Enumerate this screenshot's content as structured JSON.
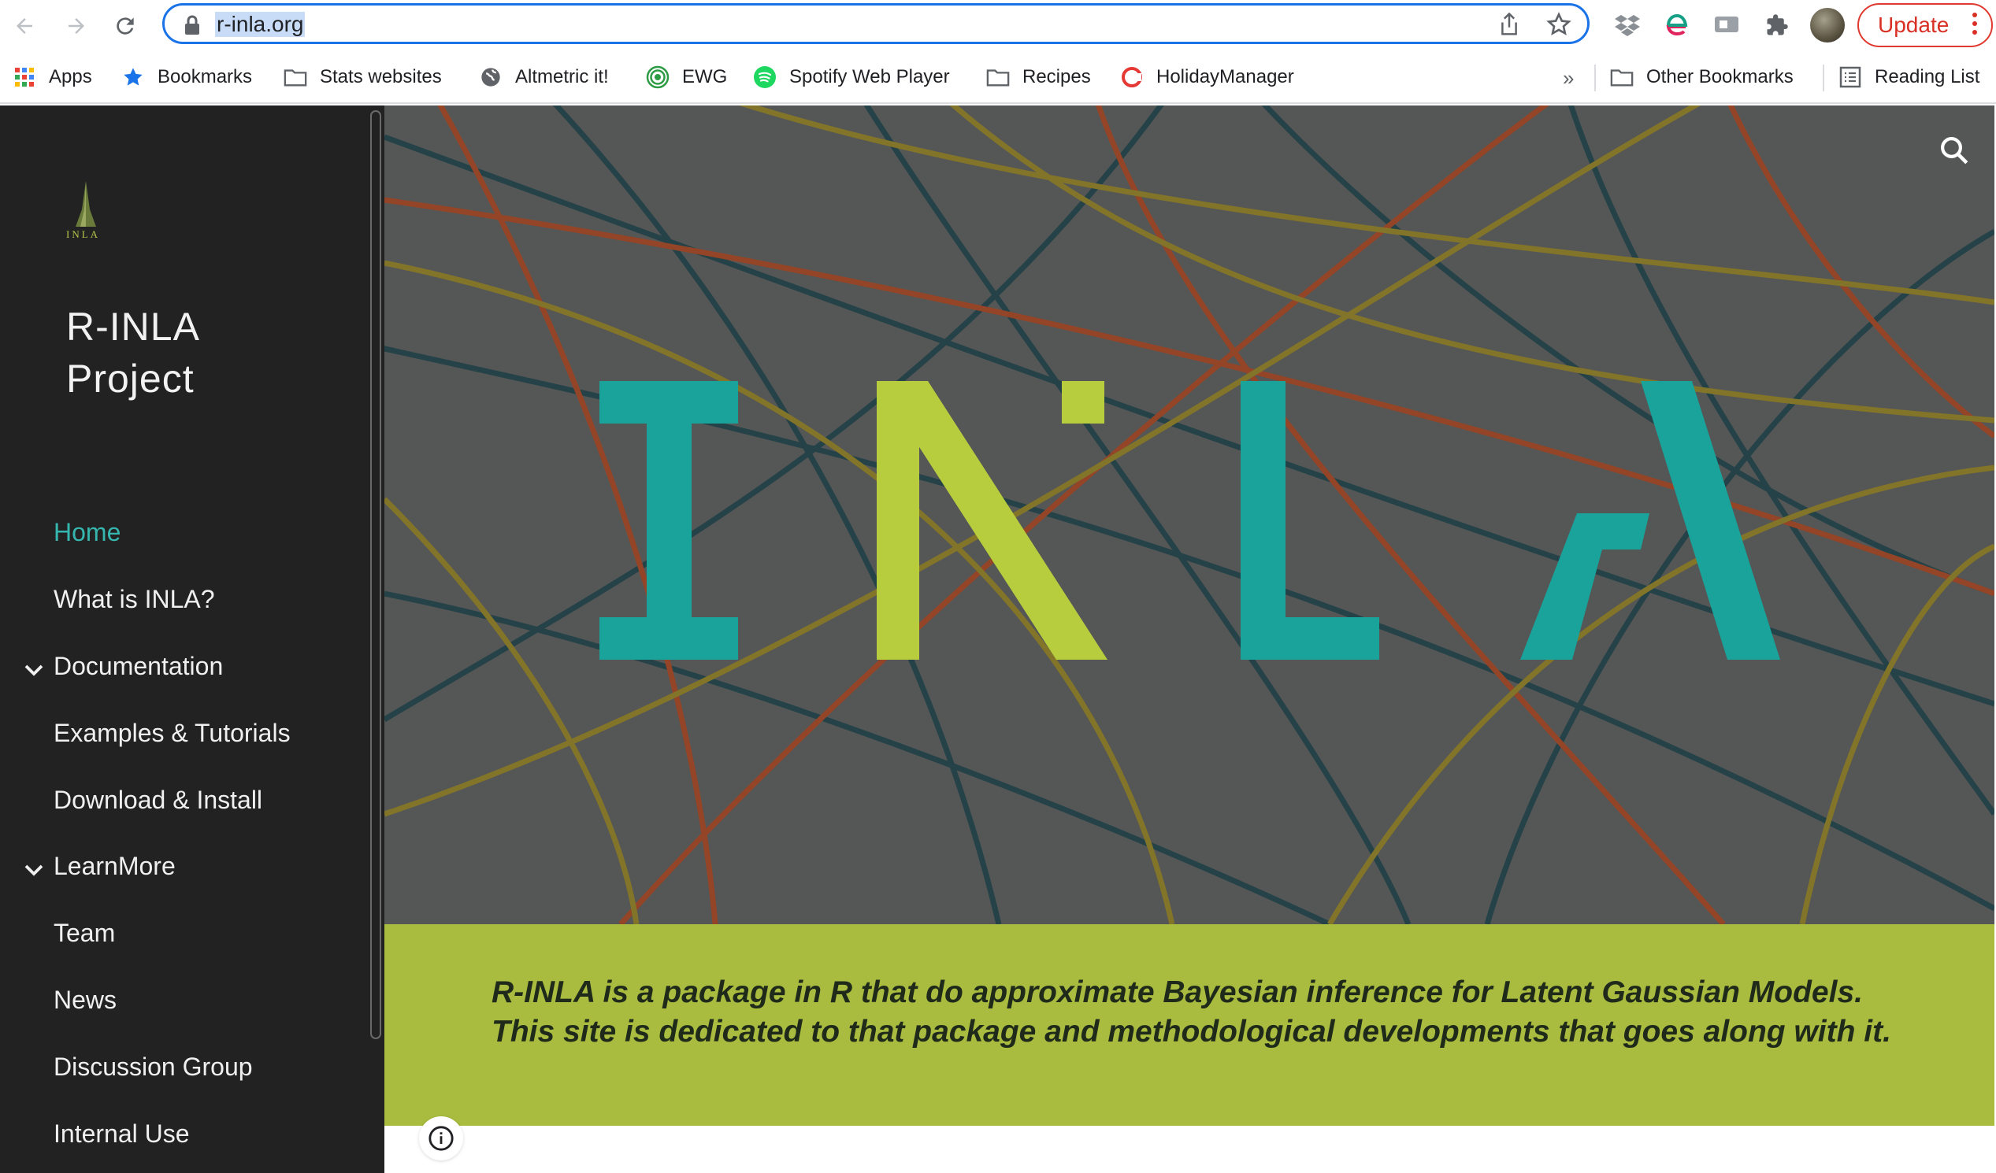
{
  "browser": {
    "url": "r-inla.org",
    "update_label": "Update",
    "more_bookmarks": "»",
    "bookmarks": [
      {
        "label": "Apps",
        "icon": "apps-grid-icon"
      },
      {
        "label": "Bookmarks",
        "icon": "star-icon"
      },
      {
        "label": "Stats websites",
        "icon": "folder-icon"
      },
      {
        "label": "Altmetric it!",
        "icon": "globe-icon"
      },
      {
        "label": "EWG",
        "icon": "ewg-icon"
      },
      {
        "label": "Spotify Web Player",
        "icon": "spotify-icon"
      },
      {
        "label": "Recipes",
        "icon": "folder-icon"
      },
      {
        "label": "HolidayManager",
        "icon": "holiday-icon"
      }
    ],
    "other_bookmarks": "Other Bookmarks",
    "reading_list": "Reading List"
  },
  "site": {
    "title_line1": "R-INLA",
    "title_line2": "Project",
    "logo_text": "INLA",
    "nav": [
      {
        "label": "Home",
        "active": true,
        "expandable": false
      },
      {
        "label": "What is INLA?",
        "active": false,
        "expandable": false
      },
      {
        "label": "Documentation",
        "active": false,
        "expandable": true
      },
      {
        "label": "Examples & Tutorials",
        "active": false,
        "expandable": false
      },
      {
        "label": "Download & Install",
        "active": false,
        "expandable": false
      },
      {
        "label": "LearnMore",
        "active": false,
        "expandable": true
      },
      {
        "label": "Team",
        "active": false,
        "expandable": false
      },
      {
        "label": "News",
        "active": false,
        "expandable": false
      },
      {
        "label": "Discussion Group",
        "active": false,
        "expandable": false
      },
      {
        "label": "Internal Use",
        "active": false,
        "expandable": false
      }
    ]
  },
  "hero": {
    "logo_letters": [
      "I",
      "N",
      "L",
      "A"
    ],
    "colors": {
      "teal": "#1aa39b",
      "lime": "#b8cd3e",
      "band": "#a9bc3f",
      "sidebar": "#222222",
      "active_nav": "#35b7b0"
    }
  },
  "tagline": "R-INLA is a package in R that do approximate Bayesian inference for Latent Gaussian Models. This site is dedicated to that package and methodological  developments that goes along with it."
}
